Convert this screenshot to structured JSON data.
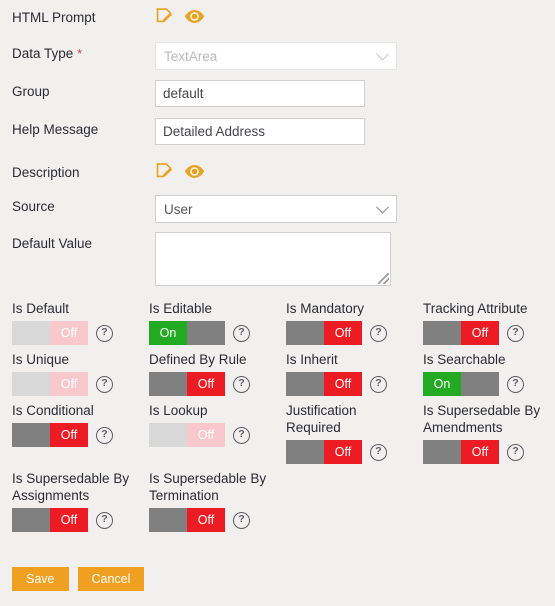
{
  "form": {
    "rows": [
      {
        "label": "HTML Prompt",
        "type": "icons"
      },
      {
        "label": "Data Type",
        "required": "*",
        "type": "select",
        "value": "TextArea",
        "disabled": true
      },
      {
        "label": "Group",
        "type": "text",
        "value": "default"
      },
      {
        "label": "Help Message",
        "type": "text",
        "value": "Detailed Address"
      },
      {
        "label": "Description",
        "type": "icons"
      },
      {
        "label": "Source",
        "type": "select",
        "value": "User",
        "disabled": false
      },
      {
        "label": "Default Value",
        "type": "textarea",
        "value": ""
      }
    ],
    "icons": {
      "edit": "edit-note-icon",
      "preview": "eye-icon"
    }
  },
  "toggles": [
    {
      "label": "Is Default",
      "state": "Off",
      "enabled": false,
      "help": "?"
    },
    {
      "label": "Is Editable",
      "state": "On",
      "enabled": true,
      "help": "?"
    },
    {
      "label": "Is Mandatory",
      "state": "Off",
      "enabled": true,
      "help": "?"
    },
    {
      "label": "Tracking Attribute",
      "state": "Off",
      "enabled": true,
      "help": "?"
    },
    {
      "label": "Is Unique",
      "state": "Off",
      "enabled": false,
      "help": "?"
    },
    {
      "label": "Defined By Rule",
      "state": "Off",
      "enabled": true,
      "help": "?"
    },
    {
      "label": "Is Inherit",
      "state": "Off",
      "enabled": true,
      "help": "?"
    },
    {
      "label": "Is Searchable",
      "state": "On",
      "enabled": true,
      "help": "?"
    },
    {
      "label": "Is Conditional",
      "state": "Off",
      "enabled": true,
      "help": "?"
    },
    {
      "label": "Is Lookup",
      "state": "Off",
      "enabled": false,
      "help": "?"
    },
    {
      "label": "Justification Required",
      "state": "Off",
      "enabled": true,
      "help": "?"
    },
    {
      "label": "Is Supersedable By Amendments",
      "state": "Off",
      "enabled": true,
      "help": "?"
    },
    {
      "label": "Is Supersedable By Assignments",
      "state": "Off",
      "enabled": true,
      "help": "?"
    },
    {
      "label": "Is Supersedable By Termination",
      "state": "Off",
      "enabled": true,
      "help": "?"
    }
  ],
  "buttons": {
    "save": "Save",
    "cancel": "Cancel"
  },
  "colors": {
    "background": "#f1f0ee",
    "accent_orange": "#f0a020",
    "toggle_on_green": "#22aa22",
    "toggle_off_red": "#ed1c24",
    "toggle_gray": "#808080",
    "toggle_disabled_gray": "#d8d8d8",
    "toggle_disabled_pink": "#f8c8cd",
    "required_red": "#e03a3a"
  }
}
